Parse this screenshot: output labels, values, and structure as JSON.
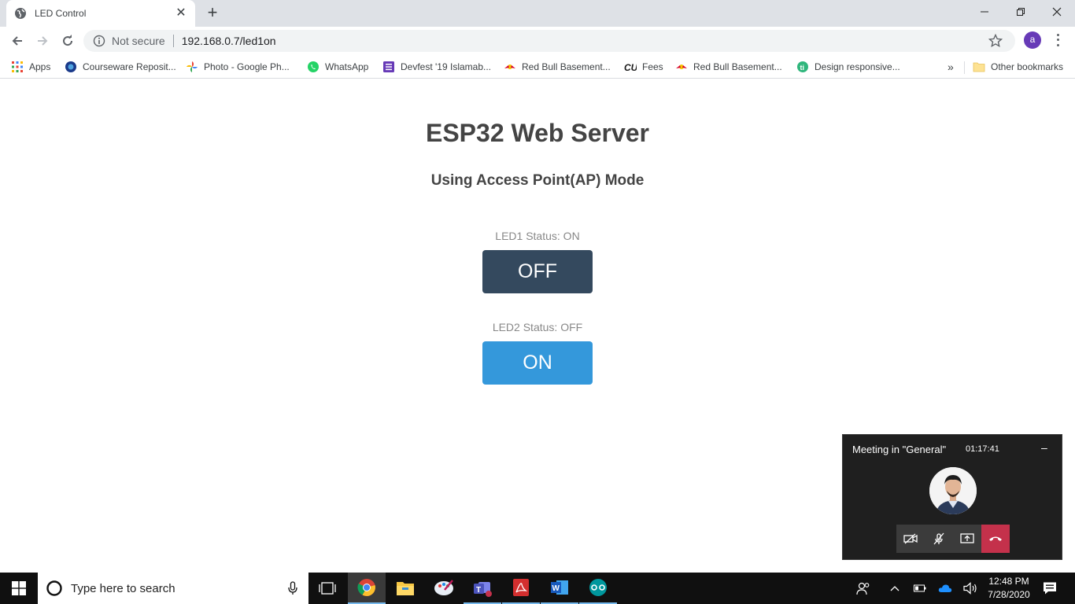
{
  "browser": {
    "tab_title": "LED Control",
    "security_label": "Not secure",
    "url": "192.168.0.7/led1on",
    "profile_initial": "a",
    "bookmarks": [
      {
        "label": "Apps",
        "icon": "apps-grid-icon"
      },
      {
        "label": "Courseware Reposit...",
        "icon": "courseware-icon"
      },
      {
        "label": "Photo - Google Ph...",
        "icon": "google-photos-icon"
      },
      {
        "label": "WhatsApp",
        "icon": "whatsapp-icon"
      },
      {
        "label": "Devfest '19 Islamab...",
        "icon": "forms-icon"
      },
      {
        "label": "Red Bull Basement...",
        "icon": "redbull-icon"
      },
      {
        "label": "Fees",
        "icon": "cu-icon"
      },
      {
        "label": "Red Bull Basement...",
        "icon": "redbull-icon"
      },
      {
        "label": "Design responsive...",
        "icon": "design-icon"
      }
    ],
    "overflow_label": "»",
    "other_bookmarks": "Other bookmarks"
  },
  "page": {
    "heading": "ESP32 Web Server",
    "subheading": "Using Access Point(AP) Mode",
    "led1_status": "LED1 Status: ON",
    "led1_button": "OFF",
    "led2_status": "LED2 Status: OFF",
    "led2_button": "ON",
    "colors": {
      "off_button": "#34495e",
      "on_button": "#3498db"
    }
  },
  "meeting": {
    "title": "Meeting in \"General\"",
    "timer": "01:17:41",
    "minimize": "–"
  },
  "taskbar": {
    "search_placeholder": "Type here to search",
    "time": "12:48 PM",
    "date": "7/28/2020"
  }
}
